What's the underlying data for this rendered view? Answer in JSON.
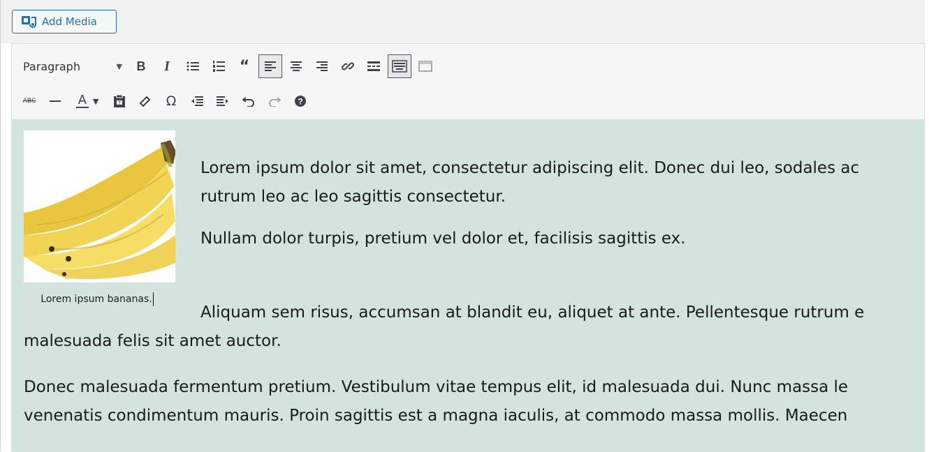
{
  "media": {
    "add_media_label": "Add Media"
  },
  "toolbar": {
    "format_value": "Paragraph",
    "row1": [
      "bold-button",
      "italic-button",
      "bullet-list-button",
      "numbered-list-button",
      "blockquote-button",
      "align-left-button",
      "align-center-button",
      "align-right-button",
      "insert-link-button",
      "read-more-button",
      "toolbar-toggle-button",
      "distraction-free-button"
    ],
    "row2": [
      "strikethrough-button",
      "horizontal-line-button",
      "text-color-button",
      "paste-as-text-button",
      "clear-formatting-button",
      "special-character-button",
      "decrease-indent-button",
      "increase-indent-button",
      "undo-button",
      "redo-button",
      "help-button"
    ],
    "bold_label": "B",
    "italic_label": "I",
    "omega_label": "Ω",
    "text_color_label": "A",
    "strike_label": "ABC",
    "accent_color": "#2271b1"
  },
  "content": {
    "image_alt": "bananas",
    "caption": "Lorem ipsum bananas.",
    "paragraphs": {
      "p1_line1": "Lorem ipsum dolor sit amet, consectetur adipiscing elit. Donec dui leo, sodales ac",
      "p1_line2": "rutrum leo ac leo sagittis consectetur.",
      "p2": "Nullam dolor turpis, pretium vel dolor et, facilisis sagittis ex.",
      "p3_line1": "Aliquam sem risus, accumsan at blandit eu, aliquet at ante. Pellentesque rutrum e",
      "p3_line2": "malesuada felis sit amet auctor.",
      "p4_line1": "Donec malesuada fermentum pretium. Vestibulum vitae tempus elit, id malesuada dui. Nunc massa le",
      "p4_line2": "venenatis condimentum mauris. Proin sagittis est a magna iaculis, at commodo massa mollis. Maecen"
    },
    "background_color": "#d3e4df"
  }
}
